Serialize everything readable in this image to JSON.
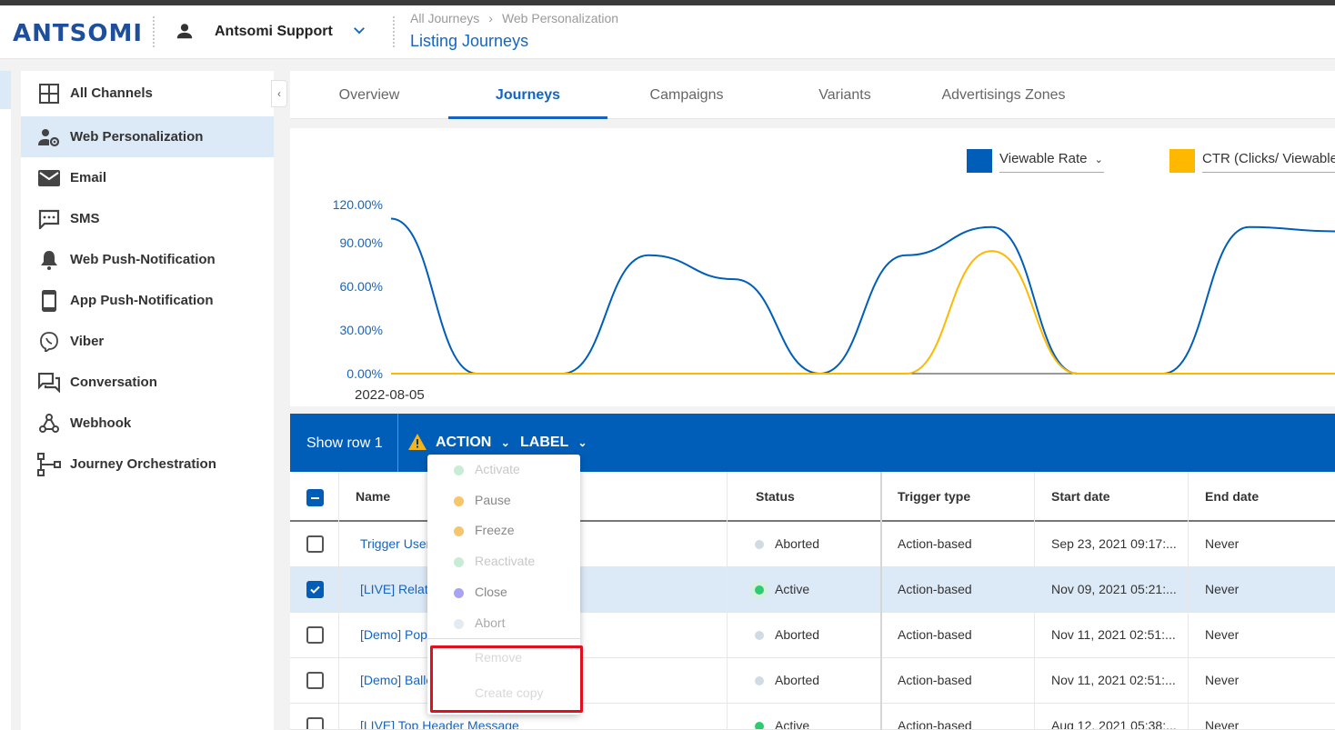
{
  "header": {
    "logo": "ANTSOMI",
    "account_name": "Antsomi Support",
    "breadcrumb": [
      "All Journeys",
      "Web Personalization"
    ],
    "page_title": "Listing Journeys"
  },
  "sidebar": {
    "items": [
      {
        "label": "All Channels",
        "icon": "grid-icon"
      },
      {
        "label": "Web Personalization",
        "icon": "user-gear-icon",
        "active": true
      },
      {
        "label": "Email",
        "icon": "envelope-icon"
      },
      {
        "label": "SMS",
        "icon": "sms-icon"
      },
      {
        "label": "Web Push-Notification",
        "icon": "bell-icon"
      },
      {
        "label": "App Push-Notification",
        "icon": "phone-icon"
      },
      {
        "label": "Viber",
        "icon": "viber-icon"
      },
      {
        "label": "Conversation",
        "icon": "chat-icon"
      },
      {
        "label": "Webhook",
        "icon": "webhook-icon"
      },
      {
        "label": "Journey Orchestration",
        "icon": "flow-icon"
      }
    ]
  },
  "tabs": [
    {
      "label": "Overview"
    },
    {
      "label": "Journeys",
      "active": true
    },
    {
      "label": "Campaigns"
    },
    {
      "label": "Variants"
    },
    {
      "label": "Advertisings Zones"
    }
  ],
  "chart": {
    "legend": [
      {
        "label": "Viewable Rate",
        "color": "#005eb8"
      },
      {
        "label": "CTR (Clicks/ Viewable)",
        "color": "#ffb800"
      }
    ],
    "yticks": [
      "120.00%",
      "90.00%",
      "60.00%",
      "30.00%",
      "0.00%"
    ],
    "xtick": "2022-08-05"
  },
  "chart_data": {
    "type": "line",
    "x_first_label": "2022-08-05",
    "ylim": [
      0,
      120
    ],
    "y_unit": "%",
    "series": [
      {
        "name": "Viewable Rate",
        "color": "#005eb8",
        "values": [
          110,
          0,
          0,
          84,
          67,
          0,
          84,
          104,
          0,
          0,
          104,
          101
        ]
      },
      {
        "name": "CTR (Clicks/ Viewable)",
        "color": "#ffb800",
        "values": [
          0,
          0,
          0,
          0,
          0,
          0,
          0,
          87,
          0,
          0,
          0,
          0
        ]
      }
    ]
  },
  "toolbar": {
    "show_row": "Show row 1",
    "action": "ACTION",
    "label": "LABEL"
  },
  "table": {
    "columns": [
      "Name",
      "Status",
      "Trigger type",
      "Start date",
      "End date"
    ],
    "rows": [
      {
        "name": "Trigger User",
        "status": "Aborted",
        "status_color": "#d0dbe3",
        "trigger": "Action-based",
        "start": "Sep 23, 2021 09:17:...",
        "end": "Never",
        "checked": false
      },
      {
        "name": "[LIVE] Relate",
        "status": "Active",
        "status_color": "#2ecc71",
        "trigger": "Action-based",
        "start": "Nov 09, 2021 05:21:...",
        "end": "Never",
        "checked": true
      },
      {
        "name": "[Demo] Popu",
        "status": "Aborted",
        "status_color": "#d0dbe3",
        "trigger": "Action-based",
        "start": "Nov 11, 2021 02:51:...",
        "end": "Never",
        "checked": false
      },
      {
        "name": "[Demo] Ballo",
        "status": "Aborted",
        "status_color": "#d0dbe3",
        "trigger": "Action-based",
        "start": "Nov 11, 2021 02:51:...",
        "end": "Never",
        "checked": false
      },
      {
        "name": "[LIVE] Top Header Message",
        "status": "Active",
        "status_color": "#2ecc71",
        "trigger": "Action-based",
        "start": "Aug 12, 2021 05:38:...",
        "end": "Never",
        "checked": false
      }
    ]
  },
  "action_menu": {
    "items": [
      {
        "label": "Activate",
        "dot": "#c9ecd6",
        "disabled": true
      },
      {
        "label": "Pause",
        "dot": "#f5c66b",
        "disabled": false
      },
      {
        "label": "Freeze",
        "dot": "#f5c66b",
        "disabled": false
      },
      {
        "label": "Reactivate",
        "dot": "#c9ecd6",
        "disabled": true
      },
      {
        "label": "Close",
        "dot": "#a9a4f2",
        "disabled": false
      },
      {
        "label": "Abort",
        "dot": "#e3ebf0",
        "disabled": true
      }
    ],
    "extra": [
      {
        "label": "Remove",
        "disabled": true
      },
      {
        "label": "Create copy",
        "disabled": true
      }
    ]
  }
}
